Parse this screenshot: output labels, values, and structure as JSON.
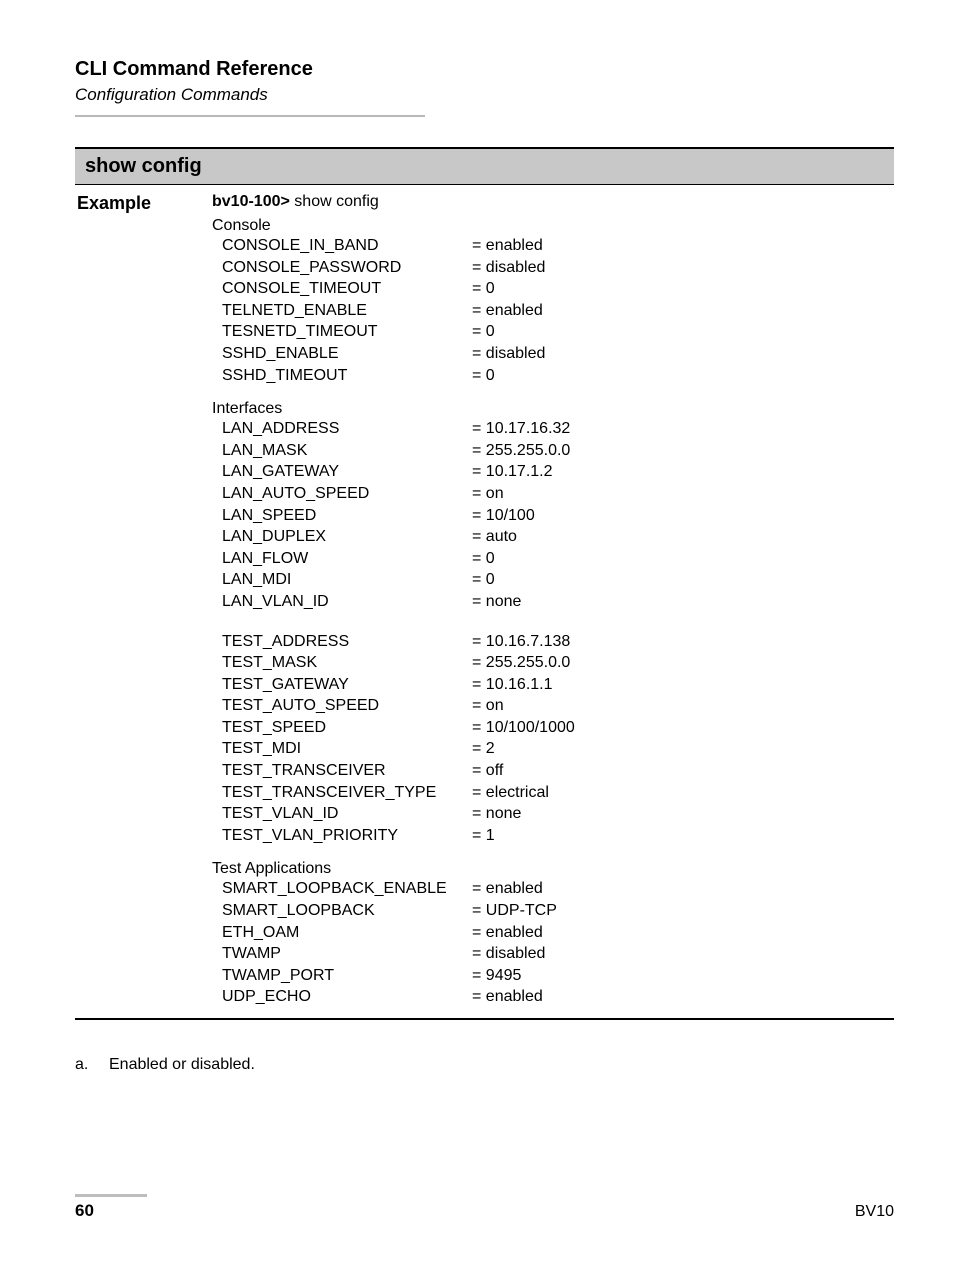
{
  "header": {
    "title": "CLI Command Reference",
    "subtitle": "Configuration Commands"
  },
  "command": {
    "name": "show config",
    "example_label": "Example",
    "prompt": "bv10-100>",
    "prompt_cmd": " show config",
    "sections": [
      {
        "name": "Console",
        "rows": [
          {
            "k": "CONSOLE_IN_BAND",
            "v": "= enabled"
          },
          {
            "k": "CONSOLE_PASSWORD",
            "v": "= disabled"
          },
          {
            "k": "CONSOLE_TIMEOUT",
            "v": "= 0"
          },
          {
            "k": "TELNETD_ENABLE",
            "v": "= enabled"
          },
          {
            "k": "TESNETD_TIMEOUT",
            "v": "= 0"
          },
          {
            "k": "SSHD_ENABLE",
            "v": "= disabled"
          },
          {
            "k": "SSHD_TIMEOUT",
            "v": "= 0"
          }
        ]
      },
      {
        "name": "Interfaces",
        "rows": [
          {
            "k": "LAN_ADDRESS",
            "v": "= 10.17.16.32"
          },
          {
            "k": "LAN_MASK",
            "v": "= 255.255.0.0"
          },
          {
            "k": "LAN_GATEWAY",
            "v": "= 10.17.1.2"
          },
          {
            "k": "LAN_AUTO_SPEED",
            "v": "= on"
          },
          {
            "k": "LAN_SPEED",
            "v": "= 10/100"
          },
          {
            "k": "LAN_DUPLEX",
            "v": "= auto"
          },
          {
            "k": "LAN_FLOW",
            "v": "= 0"
          },
          {
            "k": "LAN_MDI",
            "v": "= 0"
          },
          {
            "k": "LAN_VLAN_ID",
            "v": "= none"
          }
        ]
      },
      {
        "name": "",
        "rows": [
          {
            "k": "TEST_ADDRESS",
            "v": "= 10.16.7.138"
          },
          {
            "k": "TEST_MASK",
            "v": "= 255.255.0.0"
          },
          {
            "k": "TEST_GATEWAY",
            "v": "= 10.16.1.1"
          },
          {
            "k": "TEST_AUTO_SPEED",
            "v": "= on"
          },
          {
            "k": "TEST_SPEED",
            "v": "= 10/100/1000"
          },
          {
            "k": "TEST_MDI",
            "v": "= 2"
          },
          {
            "k": "TEST_TRANSCEIVER",
            "v": "= off"
          },
          {
            "k": "TEST_TRANSCEIVER_TYPE",
            "v": "= electrical"
          },
          {
            "k": "TEST_VLAN_ID",
            "v": "= none"
          },
          {
            "k": "TEST_VLAN_PRIORITY",
            "v": "= 1"
          }
        ]
      },
      {
        "name": "Test Applications",
        "rows": [
          {
            "k": "SMART_LOOPBACK_ENABLE",
            "v": "= enabled"
          },
          {
            "k": "SMART_LOOPBACK",
            "v": "= UDP-TCP"
          },
          {
            "k": "ETH_OAM",
            "v": "= enabled"
          },
          {
            "k": "TWAMP",
            "v": "= disabled"
          },
          {
            "k": "TWAMP_PORT",
            "v": "= 9495"
          },
          {
            "k": "UDP_ECHO",
            "v": "= enabled"
          }
        ]
      }
    ]
  },
  "footnote": {
    "label": "a.",
    "text": "Enabled or disabled."
  },
  "footer": {
    "page": "60",
    "product": "BV10"
  }
}
